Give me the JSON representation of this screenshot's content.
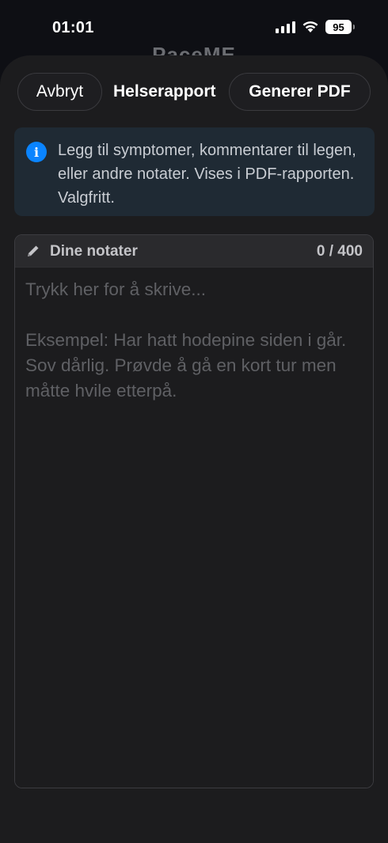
{
  "status_bar": {
    "time": "01:01",
    "battery": "95"
  },
  "background_app": {
    "title": "PaceME"
  },
  "header": {
    "cancel_label": "Avbryt",
    "title": "Helserapport",
    "generate_label": "Generer PDF"
  },
  "info": {
    "icon": "info-icon",
    "text": "Legg til symptomer, kommentarer til legen, eller andre notater. Vises i PDF-rapporten. Valgfritt."
  },
  "notes": {
    "label": "Dine notater",
    "counter": "0 / 400",
    "value": "",
    "placeholder": "Trykk her for å skrive...\n\nEksempel: Har hatt hodepine siden i går. Sov dårlig. Prøvde å gå en kort tur men måtte hvile etterpå."
  },
  "colors": {
    "accent": "#0a84ff",
    "sheet_background": "#1c1c1e",
    "info_background": "#1f2a34"
  }
}
